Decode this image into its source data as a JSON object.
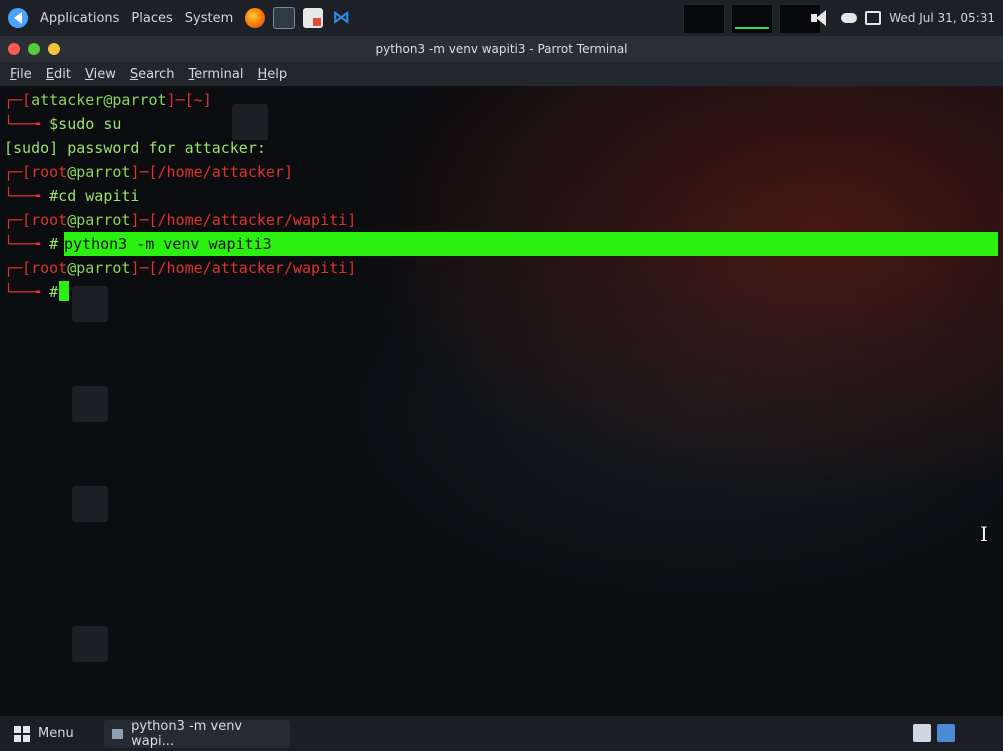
{
  "top_panel": {
    "applications": "Applications",
    "places": "Places",
    "system": "System",
    "datetime": "Wed Jul 31, 05:31"
  },
  "window": {
    "title": "python3 -m venv wapiti3 - Parrot Terminal",
    "menu": [
      "File",
      "Edit",
      "View",
      "Search",
      "Terminal",
      "Help"
    ]
  },
  "terminal": {
    "line1_user": "attacker@parrot",
    "line1_dir": "~",
    "line2_cmd": "$sudo su",
    "line3": "[sudo] password for attacker:",
    "line4_user": "root@parrot",
    "line4_dir": "/home/attacker",
    "line5_cmd": "#cd wapiti",
    "line6_user": "root@parrot",
    "line6_dir": "/home/attacker/wapiti",
    "line7_prompt": "#",
    "line7_cmd": "python3 -m venv wapiti3",
    "line8_user": "root@parrot",
    "line8_dir": "/home/attacker/wapiti",
    "line9_prompt": "#"
  },
  "taskbar": {
    "menu": "Menu",
    "task": "python3 -m venv wapi..."
  }
}
